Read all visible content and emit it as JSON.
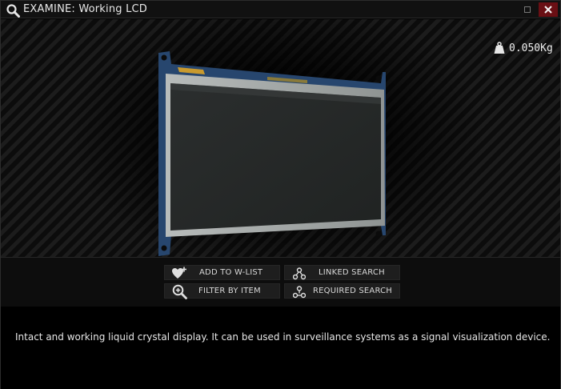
{
  "window": {
    "title": "EXAMINE: Working LCD",
    "icons": {
      "title": "magnifier-icon",
      "minimize": "minimize-icon",
      "close": "close-x-icon"
    }
  },
  "item": {
    "weight": "0.050Kg",
    "weight_icon": "weight-icon",
    "image": "working-lcd-image",
    "description": "Intact and working liquid crystal display. It can be used in surveillance systems as a signal visualization device."
  },
  "actions": {
    "add_to_wlist": {
      "label": "ADD TO W-LIST",
      "icon": "heart-plus-icon"
    },
    "linked_search": {
      "label": "LINKED SEARCH",
      "icon": "linked-nodes-icon"
    },
    "filter_by_item": {
      "label": "FILTER BY ITEM",
      "icon": "magnifier-plus-icon"
    },
    "required_search": {
      "label": "REQUIRED SEARCH",
      "icon": "required-nodes-icon"
    }
  },
  "colors": {
    "close_button": "#6a0f14",
    "background": "#000000",
    "button_bg": "#1e1e1e"
  }
}
